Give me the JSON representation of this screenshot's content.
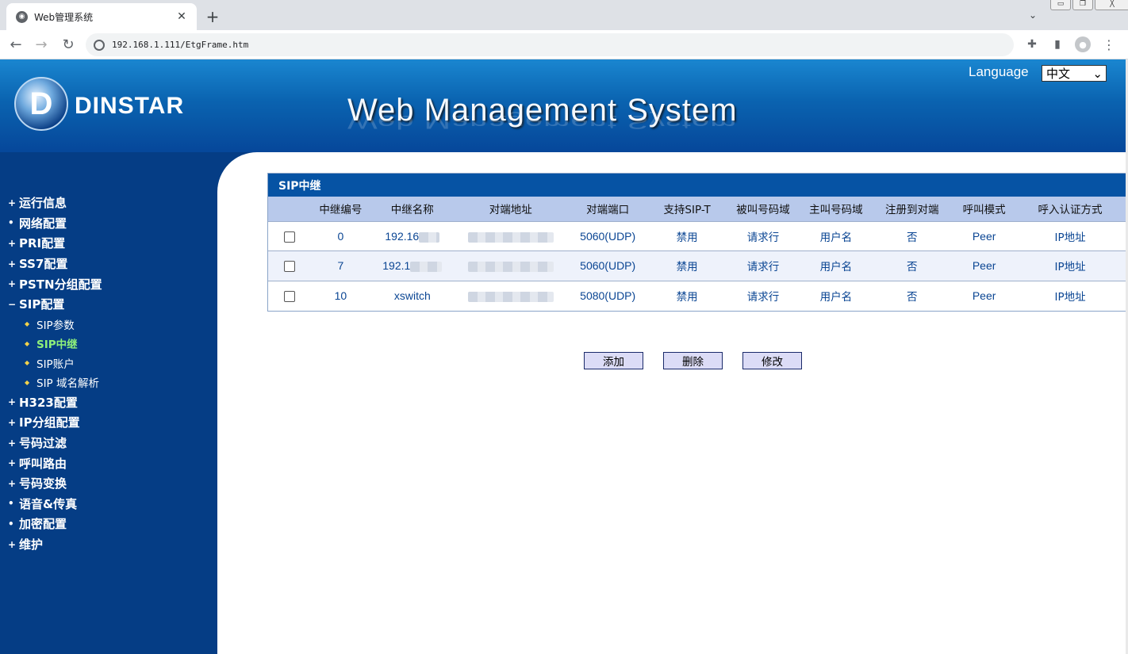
{
  "browser": {
    "tab_title": "Web管理系统",
    "tab_close": "✕",
    "new_tab": "+",
    "tabs_dropdown": "⌄",
    "url": "192.168.1.111/EtgFrame.htm",
    "window_controls": [
      "▭",
      "❐",
      "╳"
    ]
  },
  "header": {
    "logo_text": "DINSTAR",
    "title": "Web Management System",
    "language_label": "Language",
    "language_value": "中文"
  },
  "menu": {
    "items": [
      {
        "label": "运行信息",
        "bullet": "+"
      },
      {
        "label": "网络配置",
        "bullet": "•"
      },
      {
        "label": "PRI配置",
        "bullet": "+"
      },
      {
        "label": "SS7配置",
        "bullet": "+"
      },
      {
        "label": "PSTN分组配置",
        "bullet": "+"
      },
      {
        "label": "SIP配置",
        "bullet": "−"
      }
    ],
    "sip_sub": [
      {
        "label": "SIP参数"
      },
      {
        "label": "SIP中继"
      },
      {
        "label": "SIP账户"
      },
      {
        "label": "SIP 域名解析"
      }
    ],
    "items_after": [
      {
        "label": "H323配置",
        "bullet": "+"
      },
      {
        "label": "IP分组配置",
        "bullet": "+"
      },
      {
        "label": "号码过滤",
        "bullet": "+"
      },
      {
        "label": "呼叫路由",
        "bullet": "+"
      },
      {
        "label": "号码变换",
        "bullet": "+"
      },
      {
        "label": "语音&传真",
        "bullet": "•"
      },
      {
        "label": "加密配置",
        "bullet": "•"
      },
      {
        "label": "维护",
        "bullet": "+"
      }
    ]
  },
  "trunk_panel": {
    "title": "SIP中继",
    "columns": [
      "",
      "中继编号",
      "中继名称",
      "对端地址",
      "对端端口",
      "支持SIP-T",
      "被叫号码域",
      "主叫号码域",
      "注册到对端",
      "呼叫模式",
      "呼入认证方式"
    ],
    "rows": [
      {
        "id": "0",
        "name": "192.16",
        "port": "5060(UDP)",
        "sipt": "禁用",
        "called": "请求行",
        "calling": "用户名",
        "register": "否",
        "mode": "Peer",
        "auth": "IP地址"
      },
      {
        "id": "7",
        "name": "192.1",
        "port": "5060(UDP)",
        "sipt": "禁用",
        "called": "请求行",
        "calling": "用户名",
        "register": "否",
        "mode": "Peer",
        "auth": "IP地址"
      },
      {
        "id": "10",
        "name": "xswitch",
        "port": "5080(UDP)",
        "sipt": "禁用",
        "called": "请求行",
        "calling": "用户名",
        "register": "否",
        "mode": "Peer",
        "auth": "IP地址"
      }
    ]
  },
  "actions": {
    "add": "添加",
    "delete": "删除",
    "modify": "修改"
  },
  "icons": {
    "back": "←",
    "forward": "→",
    "reload": "↻",
    "extensions": "✚",
    "sidepanel": "▮",
    "profile": "●",
    "more": "⋮",
    "select_arrow": "⌄"
  }
}
